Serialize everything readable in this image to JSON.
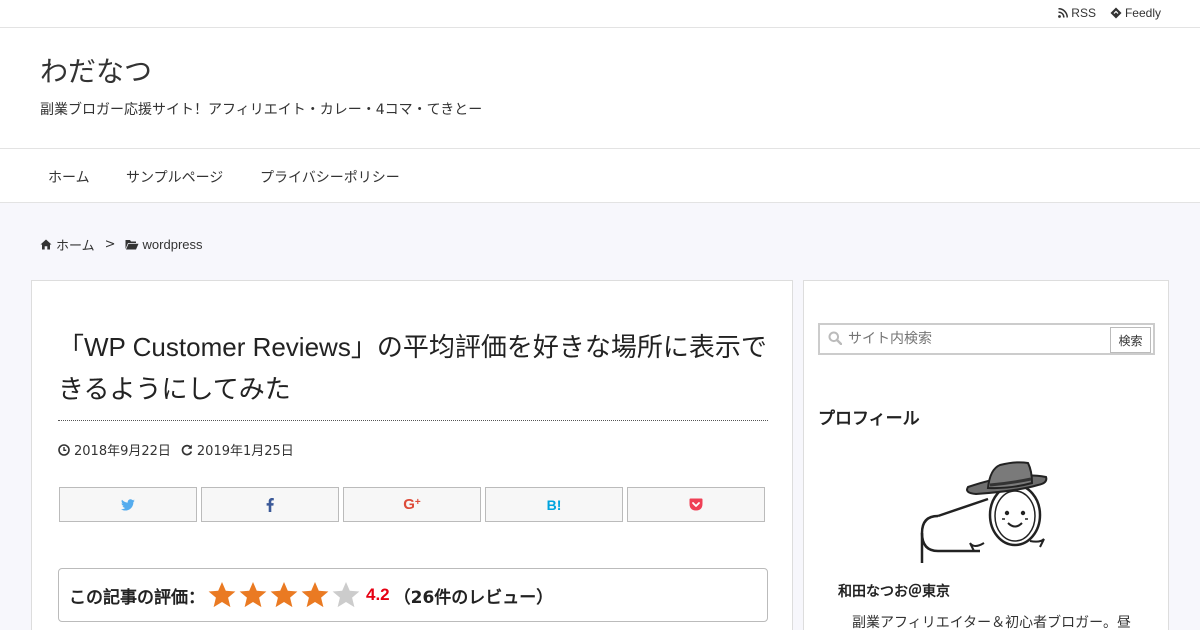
{
  "topbar": {
    "links": [
      {
        "label": "RSS",
        "icon": "rss-icon"
      },
      {
        "label": "Feedly",
        "icon": "feedly-icon"
      }
    ]
  },
  "site": {
    "title": "わだなつ",
    "description": "副業ブロガー応援サイト！アフィリエイト・カレー・4コマ・てきとー"
  },
  "nav": {
    "items": [
      "ホーム",
      "サンプルページ",
      "プライバシーポリシー"
    ]
  },
  "breadcrumb": {
    "home": "ホーム",
    "separator": ">",
    "category": "wordpress"
  },
  "post": {
    "title_open": "「",
    "title_en": "WP Customer Reviews",
    "title_rest": "」の平均評価を好きな場所に表示できるようにしてみた",
    "published": "2018年9月22日",
    "updated": "2019年1月25日",
    "share_buttons": [
      "twitter-icon",
      "facebook-icon",
      "google-plus-icon",
      "hatena-bookmark-icon",
      "pocket-icon"
    ],
    "share_colors": {
      "twitter": "#55acee",
      "facebook": "#3b5998",
      "google_plus": "#dd4b39",
      "hatena": "#00a4de",
      "pocket": "#ef4056"
    },
    "rating": {
      "label": "この記事の評価：",
      "stars": 4,
      "max_stars": 5,
      "average": "4.2",
      "count_text": "（26件のレビュー）",
      "star_color": "#ea7a22",
      "empty_star_color": "#cccccc",
      "average_color": "#e60012"
    }
  },
  "sidebar": {
    "search": {
      "placeholder": "サイト内検索",
      "button": "検索"
    },
    "profile": {
      "title": "プロフィール",
      "name": "和田なつお＠東京",
      "description": "副業アフィリエイター＆初心者ブロガー。昼"
    }
  }
}
